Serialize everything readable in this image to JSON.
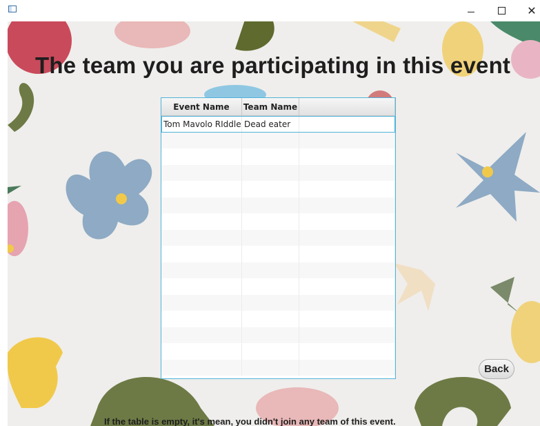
{
  "window": {
    "app_icon": "window-app-icon",
    "controls": {
      "minimize": "minimize-icon",
      "maximize": "maximize-icon",
      "close": "close-icon",
      "close_glyph": "✕"
    }
  },
  "heading": "The team you are participating in this event",
  "table": {
    "columns": [
      "Event Name",
      "Team Name",
      ""
    ],
    "rows": [
      [
        "Tom Mavolo RIddle",
        "Dead eater",
        ""
      ]
    ],
    "empty_rows": 15
  },
  "back_label": "Back",
  "footer_text": "If the table is empty, it's mean, you didn't join any team of this event.",
  "colors": {
    "table_border": "#4fb3d9",
    "heading_text": "#1e1e1e"
  }
}
